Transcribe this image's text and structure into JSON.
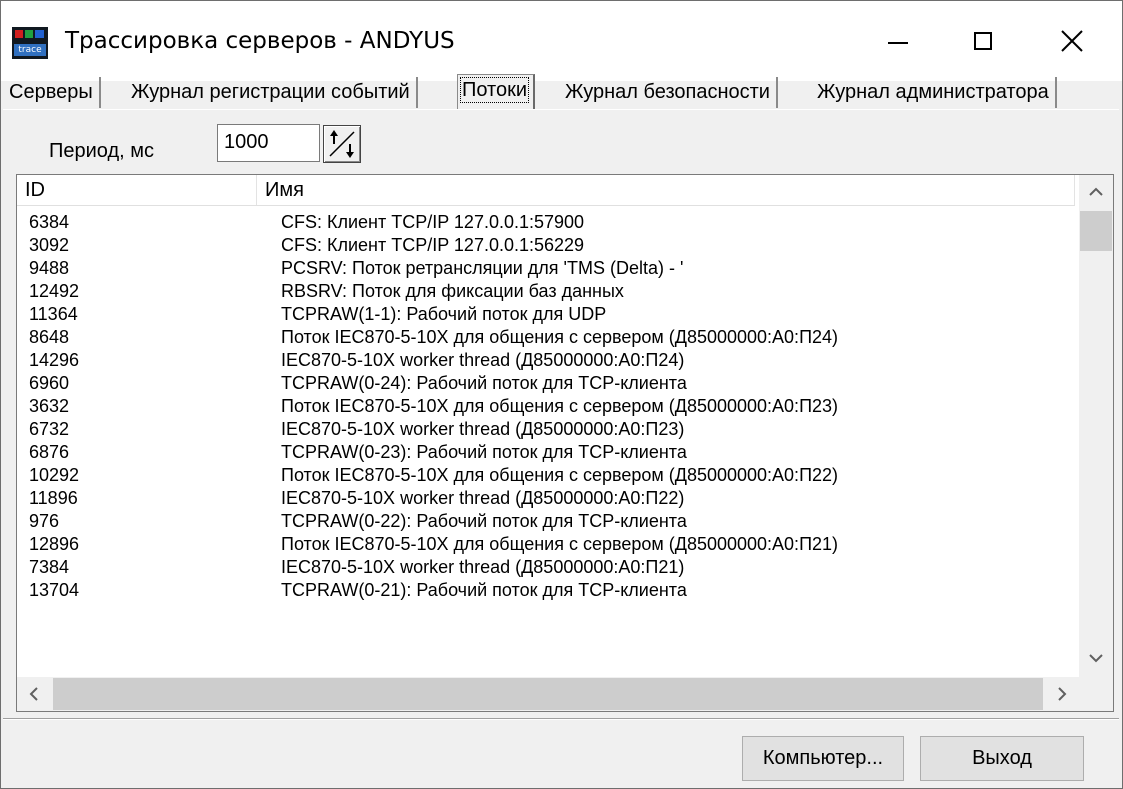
{
  "window": {
    "title": "Трассировка серверов - ANDYUS",
    "icon_text": "trace"
  },
  "tabs": [
    {
      "label": "Серверы"
    },
    {
      "label": "Журнал регистрации событий"
    },
    {
      "label": "Потоки",
      "active": true
    },
    {
      "label": "Журнал безопасности"
    },
    {
      "label": "Журнал администратора"
    }
  ],
  "period": {
    "label": "Период, мс",
    "value": "1000"
  },
  "table": {
    "headers": {
      "id": "ID",
      "name": "Имя"
    },
    "rows": [
      {
        "id": "6384",
        "name": "CFS: Клиент TCP/IP 127.0.0.1:57900"
      },
      {
        "id": "3092",
        "name": "CFS: Клиент TCP/IP 127.0.0.1:56229"
      },
      {
        "id": "9488",
        "name": "PCSRV: Поток ретрансляции для 'TMS (Delta) - '"
      },
      {
        "id": "12492",
        "name": "RBSRV: Поток для фиксации баз данных"
      },
      {
        "id": "11364",
        "name": "TCPRAW(1-1): Рабочий поток для UDP"
      },
      {
        "id": "8648",
        "name": "Поток IEC870-5-10X для общения с сервером (Д85000000:А0:П24)"
      },
      {
        "id": "14296",
        "name": "IEC870-5-10X worker thread (Д85000000:А0:П24)"
      },
      {
        "id": "6960",
        "name": "TCPRAW(0-24): Рабочий поток для TCP-клиента"
      },
      {
        "id": "3632",
        "name": "Поток IEC870-5-10X для общения с сервером (Д85000000:А0:П23)"
      },
      {
        "id": "6732",
        "name": "IEC870-5-10X worker thread (Д85000000:А0:П23)"
      },
      {
        "id": "6876",
        "name": "TCPRAW(0-23): Рабочий поток для TCP-клиента"
      },
      {
        "id": "10292",
        "name": "Поток IEC870-5-10X для общения с сервером (Д85000000:А0:П22)"
      },
      {
        "id": "11896",
        "name": "IEC870-5-10X worker thread (Д85000000:А0:П22)"
      },
      {
        "id": "976",
        "name": "TCPRAW(0-22): Рабочий поток для TCP-клиента"
      },
      {
        "id": "12896",
        "name": "Поток IEC870-5-10X для общения с сервером (Д85000000:А0:П21)"
      },
      {
        "id": "7384",
        "name": "IEC870-5-10X worker thread (Д85000000:А0:П21)"
      },
      {
        "id": "13704",
        "name": "TCPRAW(0-21): Рабочий поток для TCP-клиента"
      }
    ]
  },
  "buttons": {
    "computer": "Компьютер...",
    "exit": "Выход"
  }
}
